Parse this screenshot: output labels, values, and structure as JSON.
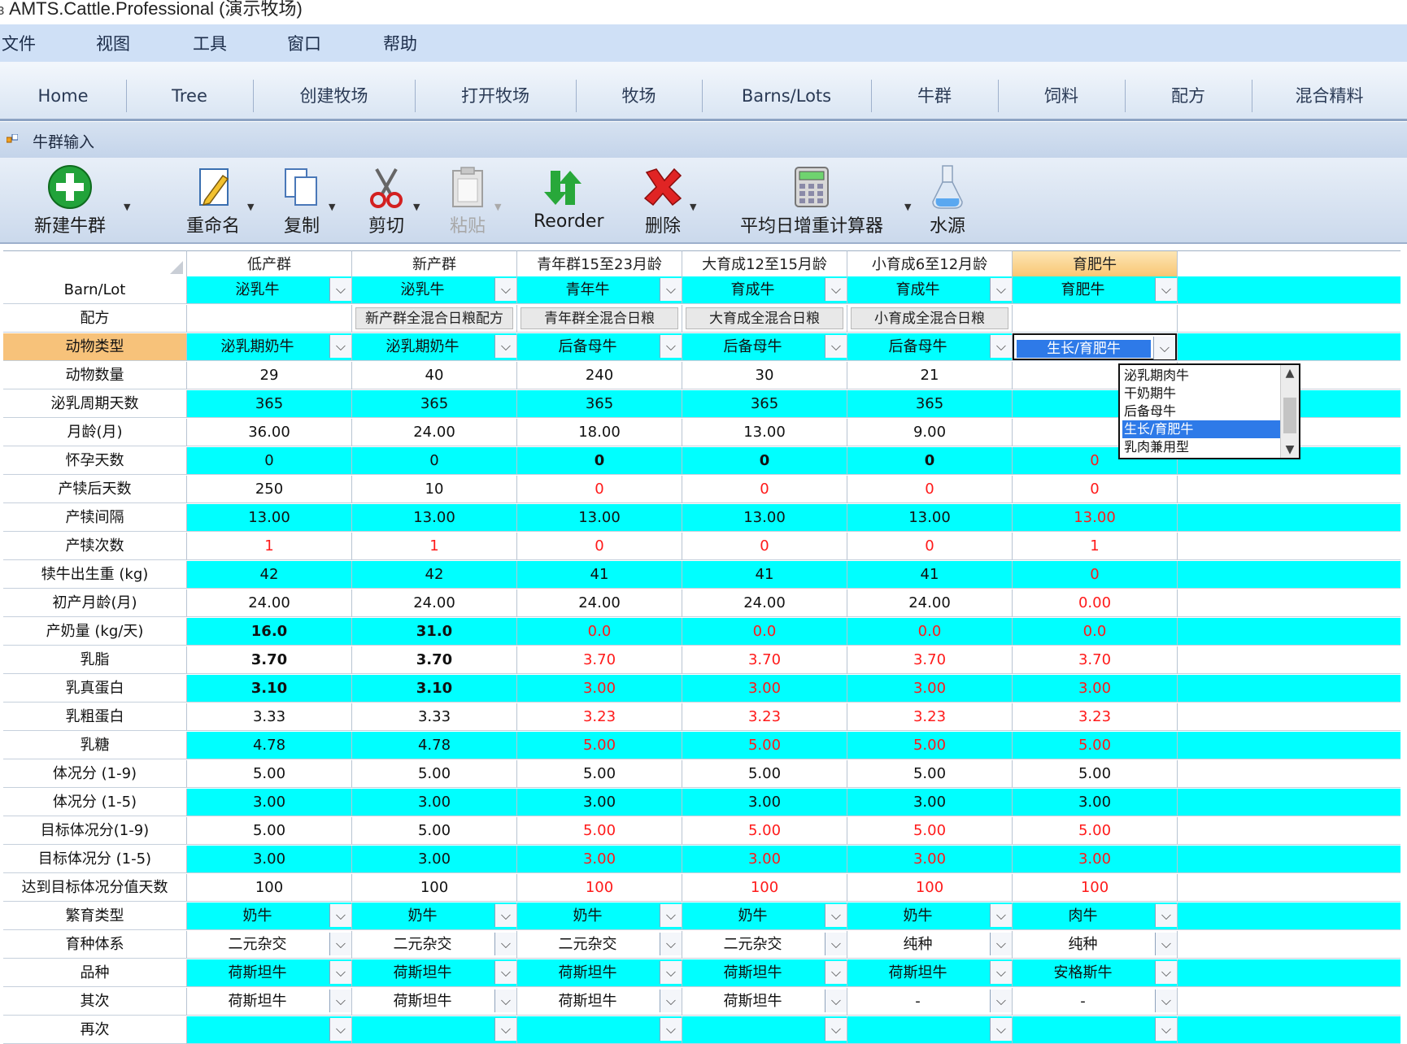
{
  "window": {
    "title": "AMTS.Cattle.Professional (演示牧场)"
  },
  "menu": [
    "文件",
    "视图",
    "工具",
    "窗口",
    "帮助"
  ],
  "ribbon_tabs": [
    "Home",
    "Tree",
    "创建牧场",
    "打开牧场",
    "牧场",
    "Barns/Lots",
    "牛群",
    "饲料",
    "配方",
    "混合精料"
  ],
  "document": {
    "title": "牛群输入"
  },
  "toolbar": {
    "new_group": "新建牛群",
    "rename": "重命名",
    "copy": "复制",
    "cut": "剪切",
    "paste": "粘贴",
    "reorder": "Reorder",
    "delete": "删除",
    "adg_calc": "平均日增重计算器",
    "water": "水源"
  },
  "columns": [
    "低产群",
    "新产群",
    "青年群15至23月龄",
    "大育成12至15月龄",
    "小育成6至12月龄",
    "育肥牛"
  ],
  "rows": [
    {
      "label": "Barn/Lot",
      "type": "dd",
      "values": [
        "泌乳牛",
        "泌乳牛",
        "青年牛",
        "育成牛",
        "育成牛",
        "育肥牛"
      ]
    },
    {
      "label": "配方",
      "type": "btn",
      "values": [
        "",
        "新产群全混合日粮配方",
        "青年群全混合日粮",
        "大育成全混合日粮",
        "小育成全混合日粮",
        ""
      ]
    },
    {
      "label": "动物类型",
      "type": "dd",
      "values": [
        "泌乳期奶牛",
        "泌乳期奶牛",
        "后备母牛",
        "后备母牛",
        "后备母牛",
        "生长/育肥牛"
      ]
    },
    {
      "label": "动物数量",
      "type": "val",
      "values": [
        "29",
        "40",
        "240",
        "30",
        "21",
        ""
      ]
    },
    {
      "label": "泌乳周期天数",
      "type": "val",
      "values": [
        "365",
        "365",
        "365",
        "365",
        "365",
        ""
      ]
    },
    {
      "label": "月龄(月)",
      "type": "val",
      "values": [
        "36.00",
        "24.00",
        "18.00",
        "13.00",
        "9.00",
        ""
      ]
    },
    {
      "label": "怀孕天数",
      "type": "val",
      "values": [
        "0",
        "0",
        "0",
        "0",
        "0",
        "0"
      ]
    },
    {
      "label": "产犊后天数",
      "type": "val",
      "values": [
        "250",
        "10",
        "0",
        "0",
        "0",
        "0"
      ]
    },
    {
      "label": "产犊间隔",
      "type": "val",
      "values": [
        "13.00",
        "13.00",
        "13.00",
        "13.00",
        "13.00",
        "13.00"
      ]
    },
    {
      "label": "产犊次数",
      "type": "val",
      "values": [
        "1",
        "1",
        "0",
        "0",
        "0",
        "1"
      ]
    },
    {
      "label": "犊牛出生重 (kg)",
      "type": "val",
      "values": [
        "42",
        "42",
        "41",
        "41",
        "41",
        "0"
      ]
    },
    {
      "label": "初产月龄(月)",
      "type": "val",
      "values": [
        "24.00",
        "24.00",
        "24.00",
        "24.00",
        "24.00",
        "0.00"
      ]
    },
    {
      "label": "产奶量 (kg/天)",
      "type": "val",
      "values": [
        "16.0",
        "31.0",
        "0.0",
        "0.0",
        "0.0",
        "0.0"
      ]
    },
    {
      "label": "乳脂",
      "type": "val",
      "values": [
        "3.70",
        "3.70",
        "3.70",
        "3.70",
        "3.70",
        "3.70"
      ]
    },
    {
      "label": "乳真蛋白",
      "type": "val",
      "values": [
        "3.10",
        "3.10",
        "3.00",
        "3.00",
        "3.00",
        "3.00"
      ]
    },
    {
      "label": "乳粗蛋白",
      "type": "val",
      "values": [
        "3.33",
        "3.33",
        "3.23",
        "3.23",
        "3.23",
        "3.23"
      ]
    },
    {
      "label": "乳糖",
      "type": "val",
      "values": [
        "4.78",
        "4.78",
        "5.00",
        "5.00",
        "5.00",
        "5.00"
      ]
    },
    {
      "label": "体况分 (1-9)",
      "type": "val",
      "values": [
        "5.00",
        "5.00",
        "5.00",
        "5.00",
        "5.00",
        "5.00"
      ]
    },
    {
      "label": "体况分 (1-5)",
      "type": "val",
      "values": [
        "3.00",
        "3.00",
        "3.00",
        "3.00",
        "3.00",
        "3.00"
      ]
    },
    {
      "label": "目标体况分(1-9)",
      "type": "val",
      "values": [
        "5.00",
        "5.00",
        "5.00",
        "5.00",
        "5.00",
        "5.00"
      ]
    },
    {
      "label": "目标体况分 (1-5)",
      "type": "val",
      "values": [
        "3.00",
        "3.00",
        "3.00",
        "3.00",
        "3.00",
        "3.00"
      ]
    },
    {
      "label": "达到目标体况分值天数",
      "type": "val",
      "values": [
        "100",
        "100",
        "100",
        "100",
        "100",
        "100"
      ]
    },
    {
      "label": "繁育类型",
      "type": "dd",
      "values": [
        "奶牛",
        "奶牛",
        "奶牛",
        "奶牛",
        "奶牛",
        "肉牛"
      ]
    },
    {
      "label": "育种体系",
      "type": "dd",
      "values": [
        "二元杂交",
        "二元杂交",
        "二元杂交",
        "二元杂交",
        "纯种",
        "纯种"
      ]
    },
    {
      "label": "品种",
      "type": "dd",
      "values": [
        "荷斯坦牛",
        "荷斯坦牛",
        "荷斯坦牛",
        "荷斯坦牛",
        "荷斯坦牛",
        "安格斯牛"
      ]
    },
    {
      "label": "其次",
      "type": "dd",
      "values": [
        "荷斯坦牛",
        "荷斯坦牛",
        "荷斯坦牛",
        "荷斯坦牛",
        "-",
        "-"
      ]
    },
    {
      "label": "再次",
      "type": "dd",
      "values": [
        "",
        "",
        "",
        "",
        "",
        ""
      ]
    }
  ],
  "animal_type_dropdown": {
    "options": [
      "泌乳期肉牛",
      "干奶期牛",
      "后备母牛",
      "生长/育肥牛",
      "乳肉兼用型"
    ],
    "selected_index": 3
  },
  "colors": {
    "cyan_row": "#00ffff",
    "selected_header": "#f8c672",
    "red_value": "#ff1a1a",
    "accent": "#2e7ae8"
  }
}
